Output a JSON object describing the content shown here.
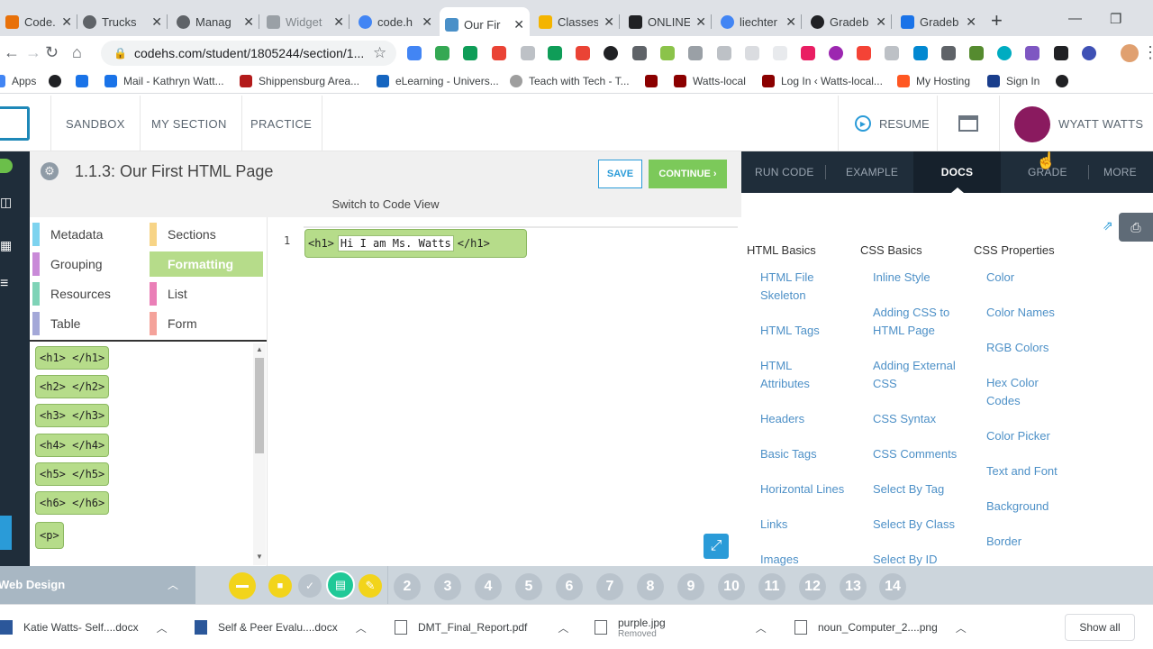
{
  "tabs": [
    {
      "title": "Code.o",
      "color": "#e8710a"
    },
    {
      "title": "Trucks",
      "color": "#5f6368"
    },
    {
      "title": "Manag",
      "color": "#5f6368"
    },
    {
      "title": "Widget",
      "color": "#5f6368"
    },
    {
      "title": "code.h",
      "color": "#4285f4"
    },
    {
      "title": "Our Fir",
      "color": "#4a90c8"
    },
    {
      "title": "Classes",
      "color": "#f4b400"
    },
    {
      "title": "ONLINE",
      "color": "#202124"
    },
    {
      "title": "liechter",
      "color": "#4285f4"
    },
    {
      "title": "Gradeb",
      "color": "#202124"
    },
    {
      "title": "Gradeb",
      "color": "#1a73e8"
    }
  ],
  "new_tab": "+",
  "url": "codehs.com/student/1805244/section/1...",
  "bookmarks": [
    {
      "label": "Apps",
      "color": "#4285f4"
    },
    {
      "label": "",
      "color": "#202124"
    },
    {
      "label": "",
      "color": "#1a73e8"
    },
    {
      "label": "Mail - Kathryn Watt...",
      "color": "#1a73e8"
    },
    {
      "label": "Shippensburg Area...",
      "color": "#b31b1b"
    },
    {
      "label": "eLearning - Univers...",
      "color": "#1565c0"
    },
    {
      "label": "Teach with Tech - T...",
      "color": "#9e9e9e"
    },
    {
      "label": "",
      "color": "#8b0000"
    },
    {
      "label": "Watts-local",
      "color": "#8b0000"
    },
    {
      "label": "Log In ‹ Watts-local...",
      "color": "#8b0000"
    },
    {
      "label": "My Hosting",
      "color": "#ff5722"
    },
    {
      "label": "Sign In",
      "color": "#1a3e8c"
    },
    {
      "label": "",
      "color": "#202124"
    }
  ],
  "header": {
    "nav": [
      "SANDBOX",
      "MY SECTION",
      "PRACTICE"
    ],
    "resume": "RESUME",
    "user": "WYATT WATTS"
  },
  "lesson": {
    "title": "1.1.3: Our First HTML Page",
    "save": "SAVE",
    "continue": "CONTINUE ›",
    "switch_view": "Switch to Code View"
  },
  "categories": [
    {
      "label": "Metadata",
      "color": "#7dd3ef"
    },
    {
      "label": "Sections",
      "color": "#f7d486"
    },
    {
      "label": "Grouping",
      "color": "#c98ad8"
    },
    {
      "label": "Formatting",
      "color": "#b6dc8a"
    },
    {
      "label": "Resources",
      "color": "#7fd3b7"
    },
    {
      "label": "List",
      "color": "#ea7fb7"
    },
    {
      "label": "Table",
      "color": "#a4a8d8"
    },
    {
      "label": "Form",
      "color": "#f4a29a"
    }
  ],
  "blocks": [
    "<h1> </h1>",
    "<h2> </h2>",
    "<h3> </h3>",
    "<h4> </h4>",
    "<h5> </h5>",
    "<h6> </h6>",
    "<p>"
  ],
  "code": {
    "line_number": "1",
    "open_tag": "<h1>",
    "text": "Hi I am Ms. Watts",
    "close_tag": "</h1>"
  },
  "right_tabs": [
    "RUN CODE",
    "EXAMPLE",
    "DOCS",
    "GRADE",
    "MORE"
  ],
  "docs": {
    "columns": [
      {
        "heading": "HTML Basics",
        "links": [
          "HTML File Skeleton",
          "HTML Tags",
          "HTML Attributes",
          "Headers",
          "Basic Tags",
          "Horizontal Lines",
          "Links",
          "Images"
        ]
      },
      {
        "heading": "CSS Basics",
        "links": [
          "Inline Style",
          "Adding CSS to HTML Page",
          "Adding External CSS",
          "CSS Syntax",
          "CSS Comments",
          "Select By Tag",
          "Select By Class",
          "Select By ID"
        ]
      },
      {
        "heading": "CSS Properties",
        "links": [
          "Color",
          "Color Names",
          "RGB Colors",
          "Hex Color Codes",
          "Color Picker",
          "Text and Font",
          "Background",
          "Border"
        ]
      }
    ]
  },
  "course": "Web Design",
  "pages": [
    "2",
    "3",
    "4",
    "5",
    "6",
    "7",
    "8",
    "9",
    "10",
    "11",
    "12",
    "13",
    "14"
  ],
  "downloads": [
    {
      "name": "Katie Watts- Self....docx",
      "sub": "",
      "color": "#2b579a"
    },
    {
      "name": "Self & Peer Evalu....docx",
      "sub": "",
      "color": "#2b579a"
    },
    {
      "name": "DMT_Final_Report.pdf",
      "sub": "",
      "color": "#5f6368"
    },
    {
      "name": "purple.jpg",
      "sub": "Removed",
      "color": "#5f6368"
    },
    {
      "name": "noun_Computer_2....png",
      "sub": "",
      "color": "#5f6368"
    }
  ],
  "show_all": "Show all"
}
